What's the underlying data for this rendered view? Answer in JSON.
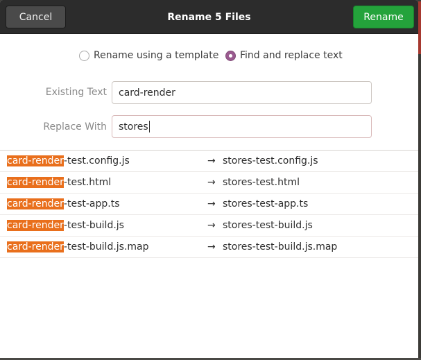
{
  "header": {
    "title": "Rename 5 Files",
    "cancel_label": "Cancel",
    "rename_label": "Rename"
  },
  "mode": {
    "template_label": "Rename using a template",
    "find_replace_label": "Find and replace text",
    "selected": "find_replace"
  },
  "form": {
    "existing_label": "Existing Text",
    "existing_value": "card-render",
    "replace_label": "Replace With",
    "replace_value": "stores"
  },
  "arrow": "→",
  "files": [
    {
      "match": "card-render",
      "rest": "-test.config.js",
      "new": "stores-test.config.js"
    },
    {
      "match": "card-render",
      "rest": "-test.html",
      "new": "stores-test.html"
    },
    {
      "match": "card-render",
      "rest": "-test-app.ts",
      "new": "stores-test-app.ts"
    },
    {
      "match": "card-render",
      "rest": "-test-build.js",
      "new": "stores-test-build.js"
    },
    {
      "match": "card-render",
      "rest": "-test-build.js.map",
      "new": "stores-test-build.js.map"
    }
  ],
  "colors": {
    "highlight": "#e96f1c",
    "rename_button": "#24a33b",
    "radio_selected": "#9a5a8f",
    "header_bg": "#2c2c2c"
  }
}
